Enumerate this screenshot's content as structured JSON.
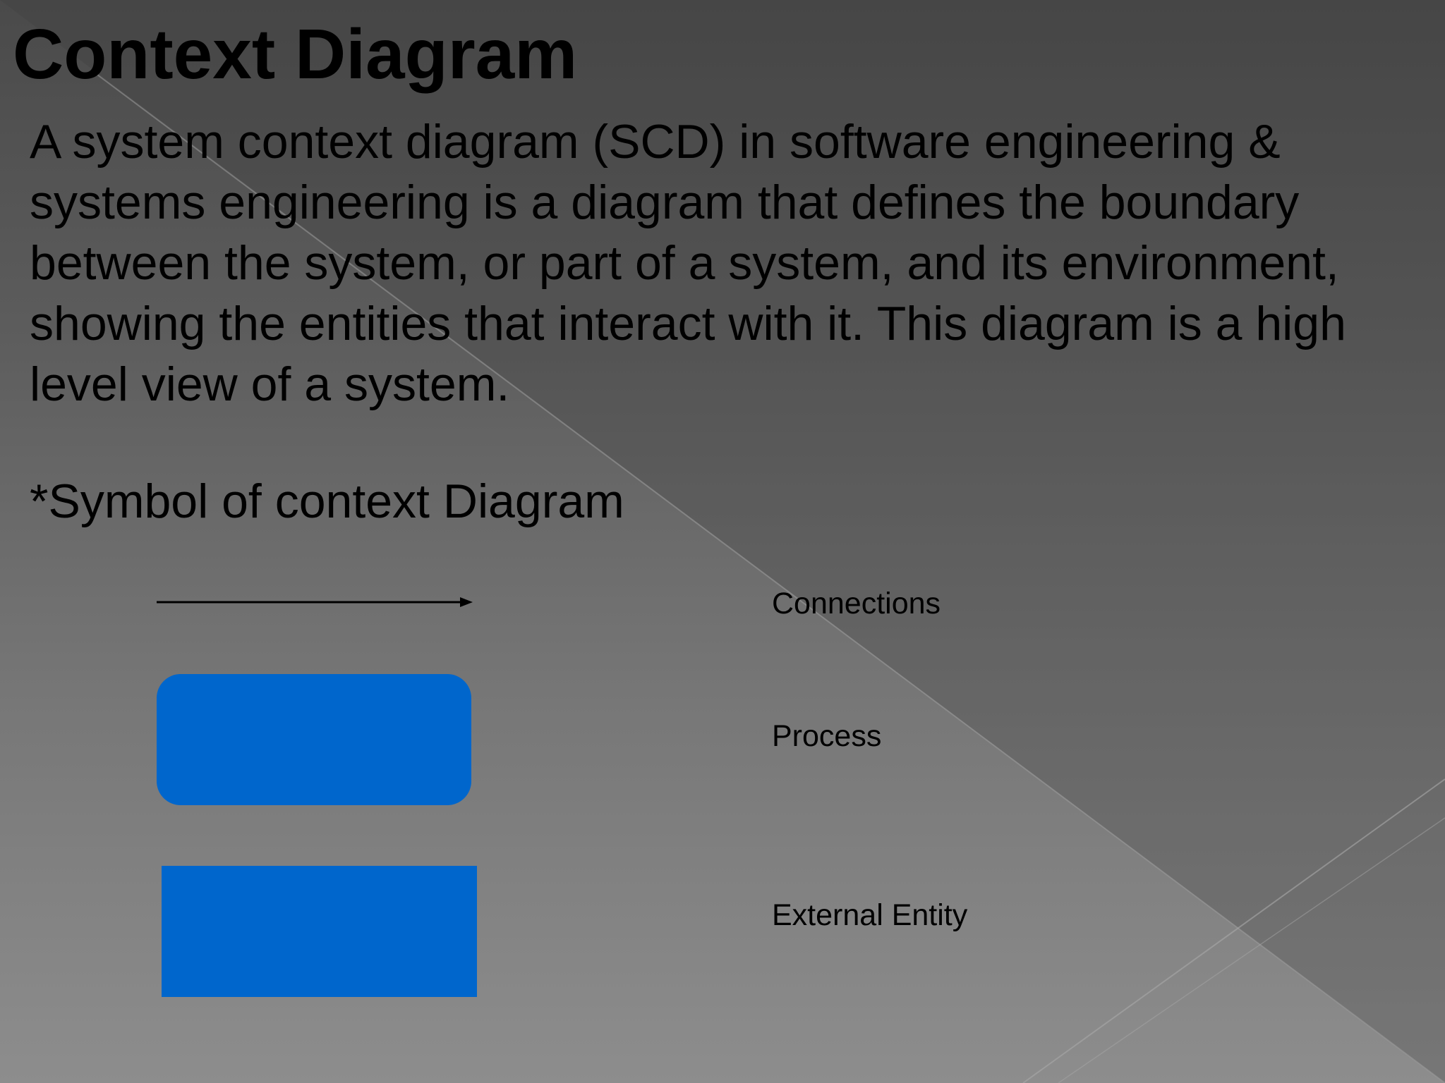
{
  "slide": {
    "title": "Context Diagram",
    "body": "A system context diagram (SCD) in software engineering & systems engineering is a diagram that defines the boundary between the system, or part of a system, and its environment, showing the entities that interact with it. This diagram is a high level view of a system.",
    "subheading": "*Symbol of context Diagram"
  },
  "legend": {
    "connections_label": "Connections",
    "process_label": "Process",
    "entity_label": "External Entity"
  },
  "colors": {
    "shape_fill": "#0066cc",
    "text": "#000000"
  }
}
